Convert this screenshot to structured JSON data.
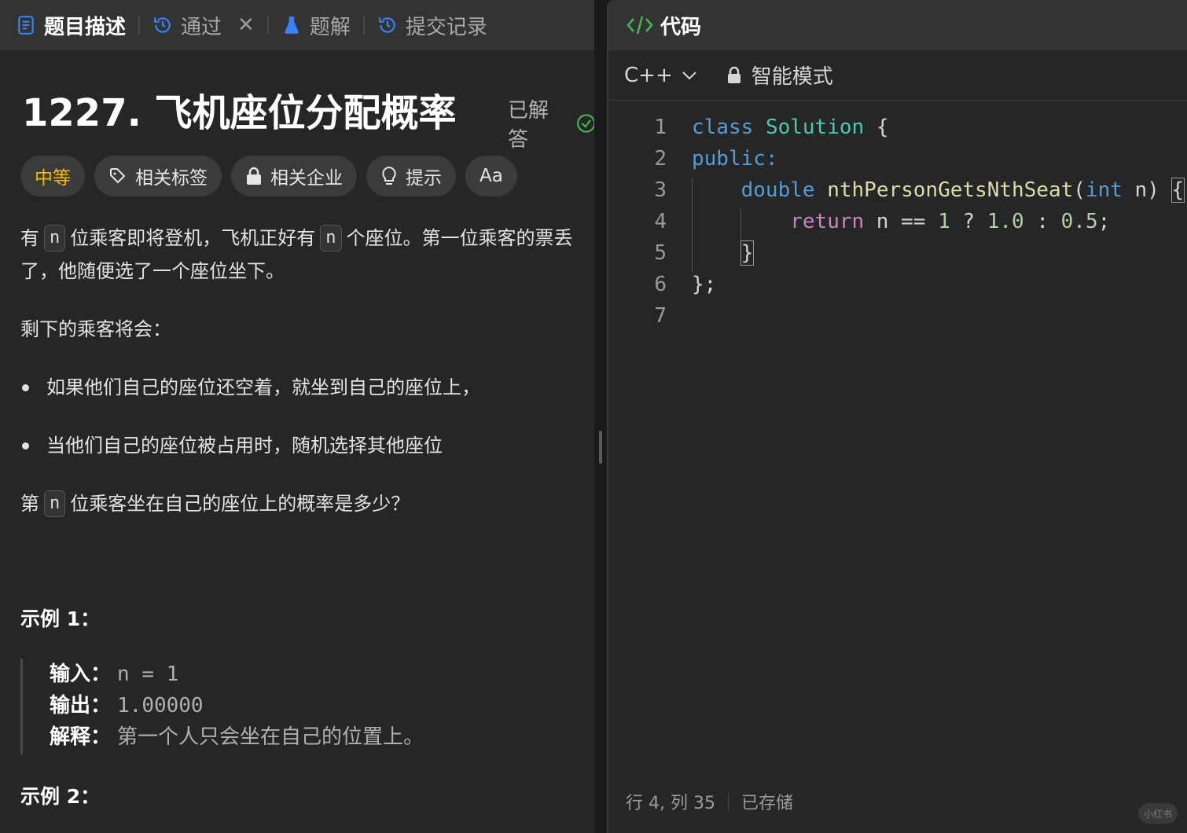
{
  "tabs": [
    {
      "label": "题目描述",
      "icon": "document-icon",
      "active": true
    },
    {
      "label": "通过",
      "icon": "history-icon"
    },
    {
      "label": "题解",
      "icon": "flask-icon"
    },
    {
      "label": "提交记录",
      "icon": "history-icon"
    }
  ],
  "problem": {
    "title": "1227. 飞机座位分配概率",
    "status": "已解答",
    "tags": [
      "中等",
      "相关标签",
      "相关企业",
      "提示",
      "Aa"
    ],
    "desc_a": "有",
    "desc_var": "n",
    "desc_b": "位乘客即将登机，飞机正好有",
    "desc_c": "个座位。第一位乘客的票丢了，他随便选了一个座位坐下。",
    "remaining": "剩下的乘客将会：",
    "rules": [
      "如果他们自己的座位还空着，就坐到自己的座位上，",
      "当他们自己的座位被占用时，随机选择其他座位"
    ],
    "question_a": "第",
    "question_b": "位乘客坐在自己的座位上的概率是多少？",
    "example1": {
      "title": "示例 1：",
      "input_label": "输入：",
      "input": "n = 1",
      "output_label": "输出：",
      "output": "1.00000",
      "explain_label": "解释：",
      "explain": "第一个人只会坐在自己的位置上。"
    },
    "example2_title": "示例 2："
  },
  "editor": {
    "title": "代码",
    "language": "C++",
    "mode": "智能模式",
    "line_numbers": [
      "1",
      "2",
      "3",
      "4",
      "5",
      "6",
      "7"
    ],
    "code": {
      "l1_kw": "class",
      "l1_name": "Solution",
      "l1_brace": " {",
      "l2": "public:",
      "l3_type": "double",
      "l3_fn": "nthPersonGetsNthSeat",
      "l3_open": "(",
      "l3_int": "int",
      "l3_rest": " n) ",
      "l3_brace": "{",
      "l4_ret": "return",
      "l4_a": " n == ",
      "l4_n1": "1",
      "l4_b": " ? ",
      "l4_n2": "1.0",
      "l4_c": " : ",
      "l4_n3": "0.5",
      "l4_d": ";",
      "l5": "}",
      "l6": "};"
    },
    "status_position": "行 4, 列 35",
    "status_saved": "已存储"
  },
  "watermark": "小红书",
  "colors": {
    "difficulty": "#ffb800",
    "solved_check": "#3fb950",
    "code_icon": "#3fb950",
    "tab_icon": "#3b82f6"
  }
}
